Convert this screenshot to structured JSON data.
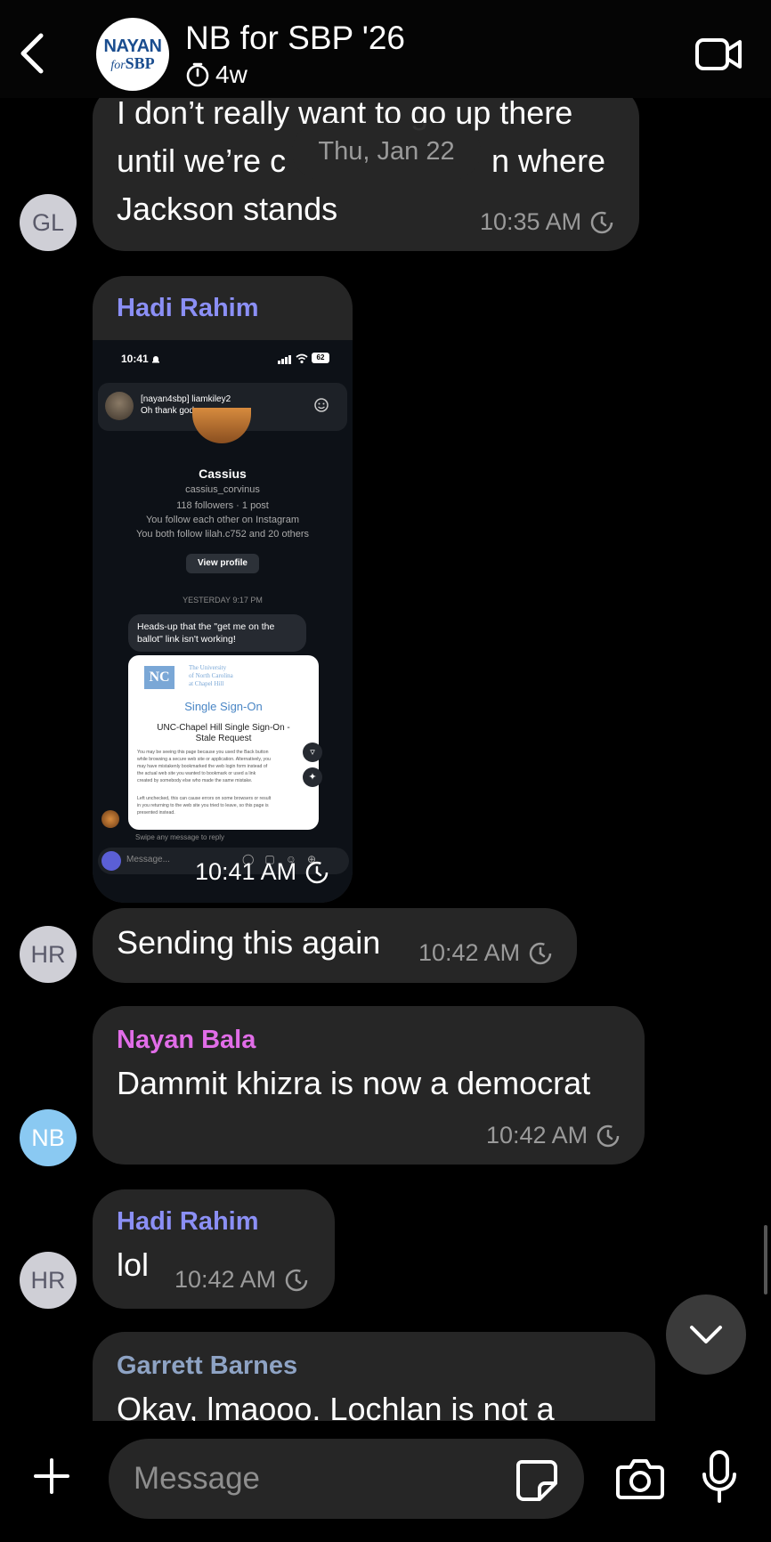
{
  "header": {
    "title": "NB for SBP '26",
    "timer": "4w",
    "avatar_line1": "NAYAN",
    "avatar_for": "for",
    "avatar_line2": "SBP"
  },
  "date_separator": "Thu, Jan 22",
  "messages": [
    {
      "sender_initials": "GL",
      "lines": [
        "I don’t really want to go up there",
        "until we’re c",
        "n where",
        "Jackson stands"
      ],
      "time": "10:35 AM"
    },
    {
      "sender": "Hadi Rahim",
      "sender_color": "#8b8ff5",
      "type": "image",
      "time": "10:41 AM"
    },
    {
      "sender_initials": "HR",
      "text": "Sending this again",
      "time": "10:42 AM"
    },
    {
      "sender": "Nayan Bala",
      "sender_color": "#e16de8",
      "sender_initials": "NB",
      "text": "Dammit khizra is now a democrat",
      "time": "10:42 AM"
    },
    {
      "sender": "Hadi Rahim",
      "sender_color": "#8b8ff5",
      "sender_initials": "HR",
      "text": "lol",
      "time": "10:42 AM"
    },
    {
      "sender": "Garrett Barnes",
      "sender_color": "#8ea3c4",
      "text": "Okay, lmaooo. Lochlan is not a"
    }
  ],
  "screenshot": {
    "status_time": "10:41",
    "battery": "62",
    "notif_title": "[nayan4sbp] liamkiley2",
    "notif_body": "Oh thank god",
    "profile_name": "Cassius",
    "profile_handle": "cassius_corvinus",
    "profile_stats": "118 followers · 1 post",
    "profile_line1": "You follow each other on Instagram",
    "profile_line2": "You both follow lilah.c752 and 20 others",
    "view_profile": "View profile",
    "timestamp": "YESTERDAY 9:17 PM",
    "dm_text_line1": "Heads-up that the \"get me on the",
    "dm_text_line2": "ballot\" link isn't working!",
    "unc_line1": "The University",
    "unc_line2": "of North Carolina",
    "unc_line3": "at Chapel Hill",
    "sso_title": "Single Sign-On",
    "stale_line1": "UNC-Chapel Hill Single Sign-On -",
    "stale_line2": "Stale Request",
    "body1": "You may be seeing this page because you used the Back button",
    "body2": "while browsing a secure web site or application. Alternatively, you",
    "body3": "may have mistakenly bookmarked the web login form instead of",
    "body4": "the actual web site you wanted to bookmark or used a link",
    "body5": "created by somebody else who made the same mistake.",
    "body6": "Left unchecked, this can cause errors on some browsers or result",
    "body7": "in you returning to the web site you tried to leave, so this page is",
    "body8": "presented instead.",
    "swipe_hint": "Swipe any message to reply",
    "composer_placeholder": "Message..."
  },
  "composer": {
    "placeholder": "Message"
  },
  "colors": {
    "bubble": "#262626",
    "background": "#000000",
    "timestamp": "#9a9a9a"
  }
}
